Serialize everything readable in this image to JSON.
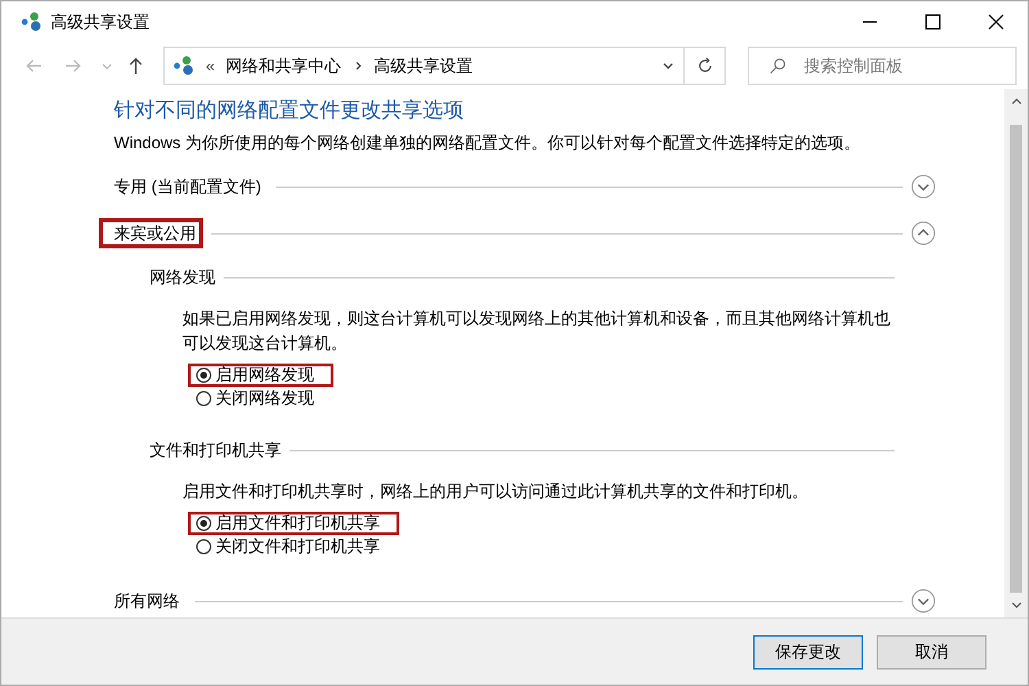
{
  "window": {
    "title": "高级共享设置"
  },
  "address_bar": {
    "overflow": "«",
    "path": [
      "网络和共享中心",
      "高级共享设置"
    ]
  },
  "search": {
    "placeholder": "搜索控制面板"
  },
  "heading": "针对不同的网络配置文件更改共享选项",
  "intro": "Windows 为你所使用的每个网络创建单独的网络配置文件。你可以针对每个配置文件选择特定的选项。",
  "profiles": [
    {
      "title": "专用 (当前配置文件)",
      "expanded": false,
      "highlighted": false
    },
    {
      "title": "来宾或公用",
      "expanded": true,
      "highlighted": true,
      "groups": [
        {
          "title": "网络发现",
          "description": "如果已启用网络发现，则这台计算机可以发现网络上的其他计算机和设备，而且其他网络计算机也可以发现这台计算机。",
          "options": [
            {
              "label": "启用网络发现",
              "selected": true,
              "highlighted": true
            },
            {
              "label": "关闭网络发现",
              "selected": false,
              "highlighted": false
            }
          ]
        },
        {
          "title": "文件和打印机共享",
          "description": "启用文件和打印机共享时，网络上的用户可以访问通过此计算机共享的文件和打印机。",
          "options": [
            {
              "label": "启用文件和打印机共享",
              "selected": true,
              "highlighted": true
            },
            {
              "label": "关闭文件和打印机共享",
              "selected": false,
              "highlighted": false
            }
          ]
        }
      ]
    },
    {
      "title": "所有网络",
      "expanded": false,
      "highlighted": false
    }
  ],
  "buttons": [
    "保存更改",
    "取消"
  ]
}
